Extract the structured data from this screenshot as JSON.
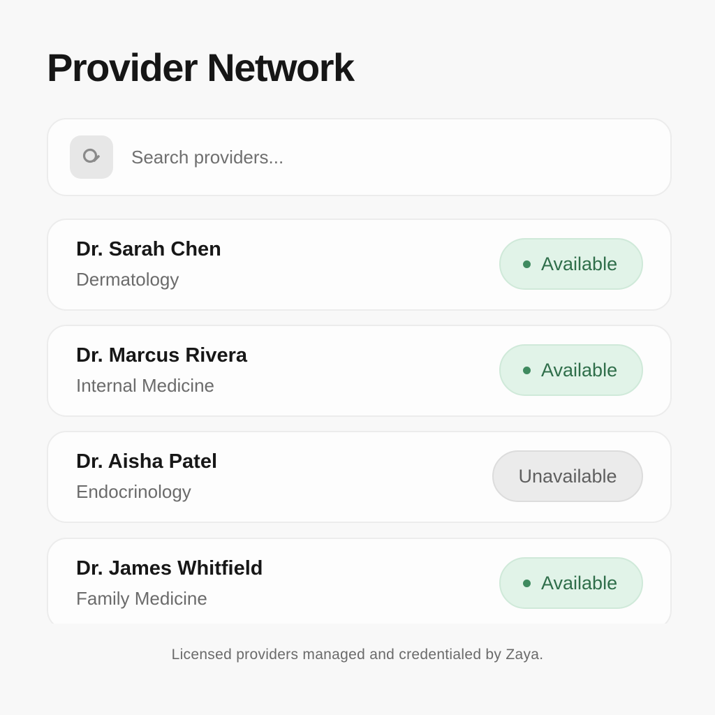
{
  "page": {
    "title": "Provider Network"
  },
  "search": {
    "icon": "search-icon",
    "placeholder": "Search providers..."
  },
  "providers": [
    {
      "name": "Dr. Sarah Chen",
      "specialty": "Dermatology",
      "status": "Available"
    },
    {
      "name": "Dr. Marcus Rivera",
      "specialty": "Internal Medicine",
      "status": "Available"
    },
    {
      "name": "Dr. Aisha Patel",
      "specialty": "Endocrinology",
      "status": "Unavailable"
    },
    {
      "name": "Dr. James Whitfield",
      "specialty": "Family Medicine",
      "status": "Available"
    }
  ],
  "footer": {
    "note": "Licensed providers managed and credentialed by Zaya."
  },
  "colors": {
    "available_bg": "#e1f3e8",
    "available_text": "#2f6e4a",
    "unavailable_bg": "#ebebeb",
    "unavailable_text": "#5f5f5f"
  }
}
